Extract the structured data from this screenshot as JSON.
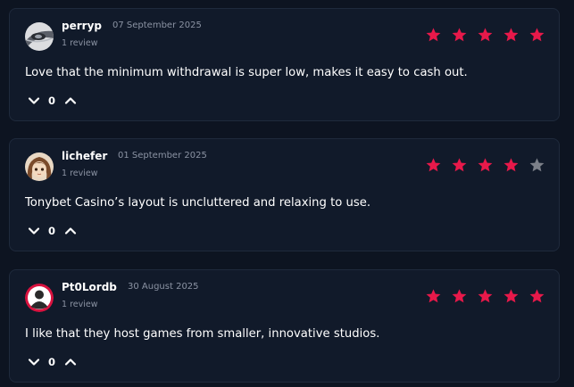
{
  "reviews": [
    {
      "username": "perryp",
      "date": "07 September 2025",
      "review_count": "1 review",
      "rating": 5,
      "text": "Love that the minimum withdrawal is super low, makes it easy to cash out.",
      "votes": "0",
      "avatar": "grey-eye-avatar"
    },
    {
      "username": "lichefer",
      "date": "01 September 2025",
      "review_count": "1 review",
      "rating": 4,
      "text": "Tonybet Casino’s layout is uncluttered and relaxing to use.",
      "votes": "0",
      "avatar": "anime-character-avatar"
    },
    {
      "username": "Pt0Lordb",
      "date": "30 August 2025",
      "review_count": "1 review",
      "rating": 5,
      "text": "I like that they host games from smaller, innovative studios.",
      "votes": "0",
      "avatar": "default-user-avatar"
    }
  ],
  "colors": {
    "background": "#0d1421",
    "card": "#111a2a",
    "card_border": "#1f2a3c",
    "star_filled": "#e8194a",
    "star_empty": "#7c8089",
    "muted_text": "#8b93a3"
  },
  "icons": {
    "star": "star-icon",
    "vote_down": "chevron-down-icon",
    "vote_up": "chevron-up-icon"
  }
}
